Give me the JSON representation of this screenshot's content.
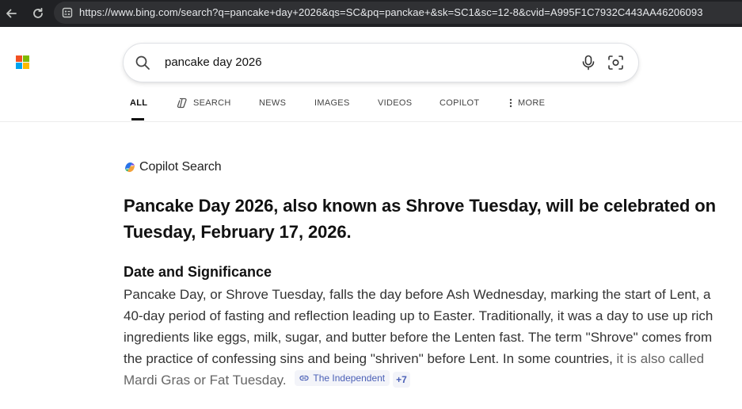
{
  "browser": {
    "url": "https://www.bing.com/search?q=pancake+day+2026&qs=SC&pq=panckae+&sk=SC1&sc=12-8&cvid=A995F1C7932C443AA46206093"
  },
  "search": {
    "query": "pancake day 2026"
  },
  "tabs": [
    {
      "label": "ALL",
      "active": true
    },
    {
      "label": "SEARCH",
      "icon": "copilot-search-icon"
    },
    {
      "label": "NEWS"
    },
    {
      "label": "IMAGES"
    },
    {
      "label": "VIDEOS"
    },
    {
      "label": "COPILOT"
    },
    {
      "label": "MORE",
      "icon": "vertical-dots-icon"
    }
  ],
  "copilot": {
    "label": "Copilot Search",
    "headline": "Pancake Day 2026, also known as Shrove Tuesday, will be celebrated on Tuesday, February 17, 2026.",
    "section_title": "Date and Significance",
    "paragraph": "Pancake Day, or Shrove Tuesday, falls the day before Ash Wednesday, marking the start of Lent, a 40-day period of fasting and reflection leading up to Easter. Traditionally, it was a day to use up rich ingredients like eggs, milk, sugar, and butter before the Lenten fast. The term \"Shrove\" comes from the practice of confessing sins and being \"shriven\" before Lent. In some countries,",
    "paragraph_end": "it is also called Mardi Gras or Fat Tuesday.",
    "citation": "The Independent",
    "citation_more": "+7"
  },
  "colors": {
    "chrome_bg": "#202124",
    "urlbar_bg": "#303134",
    "ms_red": "#f25022",
    "ms_green": "#7fba00",
    "ms_blue": "#00a4ef",
    "ms_yellow": "#ffb900",
    "citation_blue": "#4a5fb6"
  }
}
